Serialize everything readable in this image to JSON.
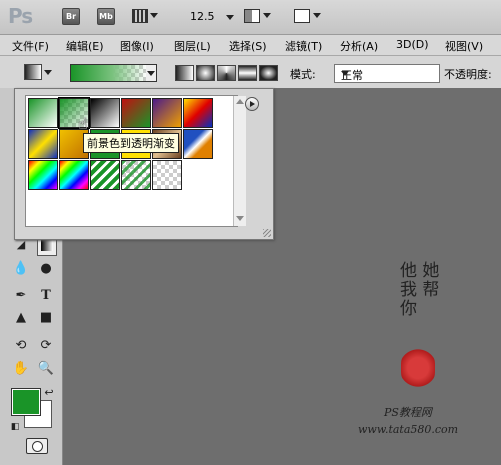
{
  "app": {
    "logo": "Ps",
    "bridge": "Br",
    "minibridge": "Mb",
    "zoom": "12.5"
  },
  "menu": [
    "文件(F)",
    "编辑(E)",
    "图像(I)",
    "图层(L)",
    "选择(S)",
    "滤镜(T)",
    "分析(A)",
    "3D(D)",
    "视图(V)"
  ],
  "options": {
    "mode_label": "模式:",
    "mode_value": "正常",
    "opacity_label": "不透明度:"
  },
  "picker": {
    "tooltip": "前景色到透明渐变"
  },
  "watermark": {
    "line1": "他 她",
    "line2": "我 帮",
    "line3": "你",
    "site": "PS教程网",
    "url": "www.tata580.com"
  },
  "colors": {
    "foreground": "#1a9428",
    "background": "#ffffff",
    "canvas": "#6e6e6e"
  }
}
